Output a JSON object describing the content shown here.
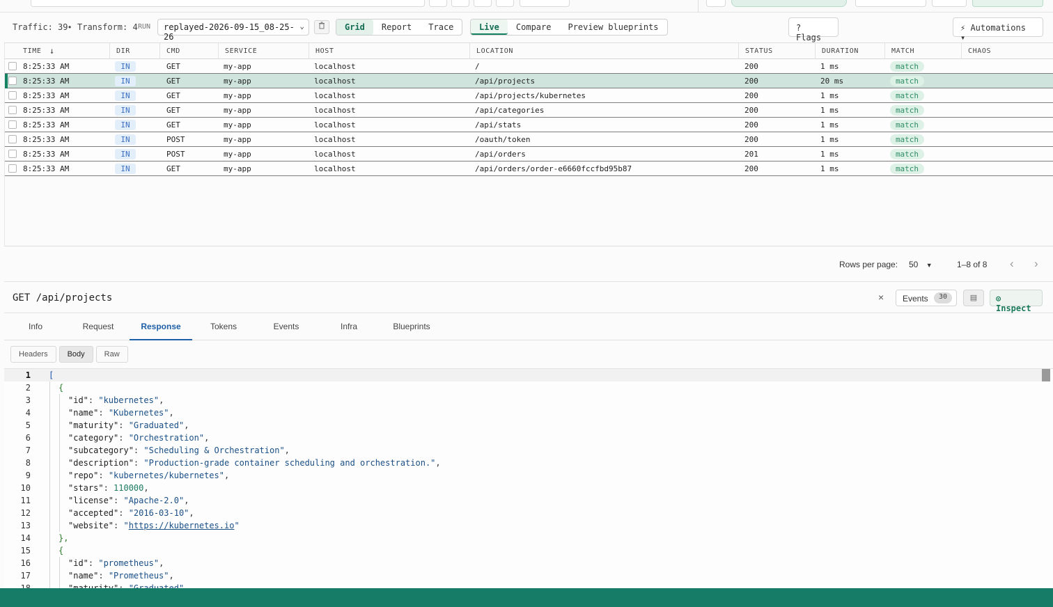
{
  "toolbar": {
    "traffic": "Traffic: 39",
    "dot": "•",
    "transform": "Transform: 4",
    "run_label": "RUN",
    "run_value": "replayed-2026-09-15_08-25-26",
    "views": [
      "Grid",
      "Report",
      "Trace"
    ],
    "modes": [
      "Live",
      "Compare",
      "Preview blueprints"
    ],
    "flags": "? Flags",
    "automations": "⚡ Automations ▾"
  },
  "grid": {
    "columns": [
      "TIME",
      "DIR",
      "CMD",
      "SERVICE",
      "HOST",
      "LOCATION",
      "STATUS",
      "DURATION",
      "MATCH",
      "CHAOS"
    ],
    "sort_icon": "↓",
    "rows": [
      {
        "time": "8:25:33 AM",
        "dir": "IN",
        "cmd": "GET",
        "service": "my-app",
        "host": "localhost",
        "location": "/",
        "status": "200",
        "duration": "1 ms",
        "match": "match"
      },
      {
        "time": "8:25:33 AM",
        "dir": "IN",
        "cmd": "GET",
        "service": "my-app",
        "host": "localhost",
        "location": "/api/projects",
        "status": "200",
        "duration": "20 ms",
        "match": "match"
      },
      {
        "time": "8:25:33 AM",
        "dir": "IN",
        "cmd": "GET",
        "service": "my-app",
        "host": "localhost",
        "location": "/api/projects/kubernetes",
        "status": "200",
        "duration": "1 ms",
        "match": "match"
      },
      {
        "time": "8:25:33 AM",
        "dir": "IN",
        "cmd": "GET",
        "service": "my-app",
        "host": "localhost",
        "location": "/api/categories",
        "status": "200",
        "duration": "1 ms",
        "match": "match"
      },
      {
        "time": "8:25:33 AM",
        "dir": "IN",
        "cmd": "GET",
        "service": "my-app",
        "host": "localhost",
        "location": "/api/stats",
        "status": "200",
        "duration": "1 ms",
        "match": "match"
      },
      {
        "time": "8:25:33 AM",
        "dir": "IN",
        "cmd": "POST",
        "service": "my-app",
        "host": "localhost",
        "location": "/oauth/token",
        "status": "200",
        "duration": "1 ms",
        "match": "match"
      },
      {
        "time": "8:25:33 AM",
        "dir": "IN",
        "cmd": "POST",
        "service": "my-app",
        "host": "localhost",
        "location": "/api/orders",
        "status": "201",
        "duration": "1 ms",
        "match": "match"
      },
      {
        "time": "8:25:33 AM",
        "dir": "IN",
        "cmd": "GET",
        "service": "my-app",
        "host": "localhost",
        "location": "/api/orders/order-e6660fccfbd95b87",
        "status": "200",
        "duration": "1 ms",
        "match": "match"
      }
    ],
    "selected_row": 1
  },
  "pager": {
    "rows_label": "Rows per page:",
    "rows_value": "50",
    "range": "1–8 of 8",
    "prev": "‹",
    "next": "›"
  },
  "detail": {
    "title": "GET /api/projects",
    "close": "×",
    "events_label": "Events",
    "events_count": "30",
    "inspect": "⊙ Inspect",
    "tabs": [
      "Info",
      "Request",
      "Response",
      "Tokens",
      "Events",
      "Infra",
      "Blueprints"
    ],
    "active_tab": "Response",
    "subtabs": [
      "Headers",
      "Body",
      "Raw"
    ],
    "active_subtab": "Body"
  },
  "code": {
    "lines": [
      {
        "n": "1",
        "indent": 0,
        "kind": "open1",
        "text": "["
      },
      {
        "n": "2",
        "indent": 1,
        "kind": "open2",
        "text": "{"
      },
      {
        "n": "3",
        "indent": 2,
        "key": "\"id\"",
        "val": "\"kubernetes\"",
        "vt": "s"
      },
      {
        "n": "4",
        "indent": 2,
        "key": "\"name\"",
        "val": "\"Kubernetes\"",
        "vt": "s"
      },
      {
        "n": "5",
        "indent": 2,
        "key": "\"maturity\"",
        "val": "\"Graduated\"",
        "vt": "s"
      },
      {
        "n": "6",
        "indent": 2,
        "key": "\"category\"",
        "val": "\"Orchestration\"",
        "vt": "s"
      },
      {
        "n": "7",
        "indent": 2,
        "key": "\"subcategory\"",
        "val": "\"Scheduling & Orchestration\"",
        "vt": "s"
      },
      {
        "n": "8",
        "indent": 2,
        "key": "\"description\"",
        "val": "\"Production-grade container scheduling and orchestration.\"",
        "vt": "s"
      },
      {
        "n": "9",
        "indent": 2,
        "key": "\"repo\"",
        "val": "\"kubernetes/kubernetes\"",
        "vt": "s"
      },
      {
        "n": "10",
        "indent": 2,
        "key": "\"stars\"",
        "val": "110000",
        "vt": "n"
      },
      {
        "n": "11",
        "indent": 2,
        "key": "\"license\"",
        "val": "\"Apache-2.0\"",
        "vt": "s"
      },
      {
        "n": "12",
        "indent": 2,
        "key": "\"accepted\"",
        "val": "\"2016-03-10\"",
        "vt": "s"
      },
      {
        "n": "13",
        "indent": 2,
        "key": "\"website\"",
        "val": "https://kubernetes.io",
        "vt": "link",
        "last": true
      },
      {
        "n": "14",
        "indent": 1,
        "kind": "close2",
        "text": "},"
      },
      {
        "n": "15",
        "indent": 1,
        "kind": "open2",
        "text": "{"
      },
      {
        "n": "16",
        "indent": 2,
        "key": "\"id\"",
        "val": "\"prometheus\"",
        "vt": "s"
      },
      {
        "n": "17",
        "indent": 2,
        "key": "\"name\"",
        "val": "\"Prometheus\"",
        "vt": "s"
      },
      {
        "n": "18",
        "indent": 2,
        "key": "\"maturity\"",
        "val": "\"Graduated\"",
        "vt": "s"
      }
    ]
  },
  "colors": {
    "accent": "#158263",
    "selected_row": "#cfe4dc",
    "bottom_bar": "#167c68"
  }
}
